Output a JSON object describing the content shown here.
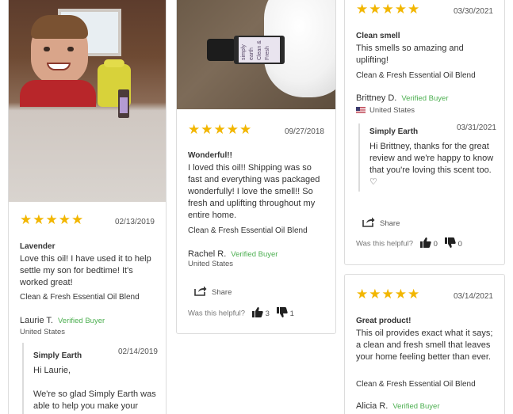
{
  "reviews": {
    "col1": {
      "photo_desc": "",
      "stars": "★★★★★",
      "date": "02/13/2019",
      "title": "Lavender",
      "body": "Love this oil! I have used it to help settle my son for bedtime! It's worked great!",
      "product": "Clean & Fresh Essential Oil Blend",
      "name": "Laurie T.",
      "verified": "Verified Buyer",
      "country": "United States",
      "reply": {
        "name": "Simply Earth",
        "date": "02/14/2019",
        "greeting": "Hi Laurie,",
        "body": "We're so glad Simply Earth was able to help you make your"
      }
    },
    "col2": {
      "bottle_label": "Clean & Fresh",
      "bottle_brand": "simply earth",
      "stars": "★★★★★",
      "date": "09/27/2018",
      "title": "Wonderful!!",
      "body": "I loved this oil!! Shipping was so fast and everything was packaged wonderfully! I love the smell!! So fresh and uplifting throughout my entire home.",
      "product": "Clean & Fresh Essential Oil Blend",
      "name": "Rachel R.",
      "verified": "Verified Buyer",
      "country": "United States",
      "share": "Share",
      "helpful": "Was this helpful?",
      "up": "3",
      "down": "1"
    },
    "col3a": {
      "stars": "★★★★★",
      "date": "03/30/2021",
      "title": "Clean smell",
      "body": "This smells so amazing and uplifting!",
      "product": "Clean & Fresh Essential Oil Blend",
      "name": "Brittney D.",
      "verified": "Verified Buyer",
      "country": "United States",
      "reply": {
        "name": "Simply Earth",
        "date": "03/31/2021",
        "body": "Hi Brittney, thanks for the great review and we're happy to know that you're loving this scent too. ♡"
      },
      "share": "Share",
      "helpful": "Was this helpful?",
      "up": "0",
      "down": "0"
    },
    "col3b": {
      "stars": "★★★★★",
      "date": "03/14/2021",
      "title": "Great product!",
      "body": "This oil provides exact what it says; a clean and fresh smell that leaves your home feeling better than ever.",
      "product": "Clean & Fresh Essential Oil Blend",
      "name": "Alicia R.",
      "verified": "Verified Buyer"
    }
  },
  "colors": {
    "star": "#f2b600",
    "verified": "#4caf50",
    "border": "#dcdcdc"
  },
  "icons": {
    "share": "share-icon",
    "thumb_up": "thumbs-up-icon",
    "thumb_down": "thumbs-down-icon",
    "flag": "us-flag-icon"
  }
}
